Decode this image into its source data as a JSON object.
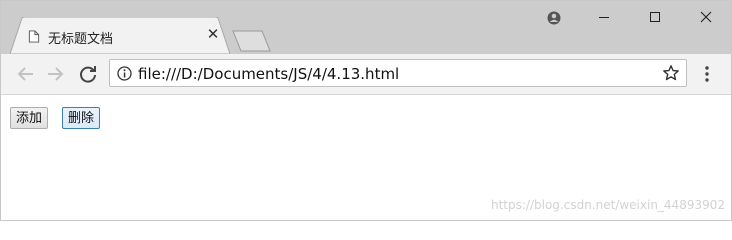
{
  "tab": {
    "title": "无标题文档",
    "close_glyph": "✕",
    "icon": "page-icon"
  },
  "window_controls": {
    "account": "account-icon",
    "minimize": "minimize-icon",
    "maximize": "maximize-icon",
    "close": "close-icon"
  },
  "toolbar": {
    "back_icon": "arrow-left-icon",
    "forward_icon": "arrow-right-icon",
    "reload_icon": "reload-icon",
    "url": "file:///D:/Documents/JS/4/4.13.html",
    "bookmark_icon": "star-icon",
    "menu_icon": "kebab-menu-icon"
  },
  "page": {
    "buttons": [
      {
        "label": "添加"
      },
      {
        "label": "删除",
        "focused": true
      }
    ],
    "watermark": "https://blog.csdn.net/weixin_44893902"
  },
  "colors": {
    "titlebar": "#cccccc",
    "toolbar": "#f2f2f2",
    "focus_border": "#3c7fb1"
  }
}
